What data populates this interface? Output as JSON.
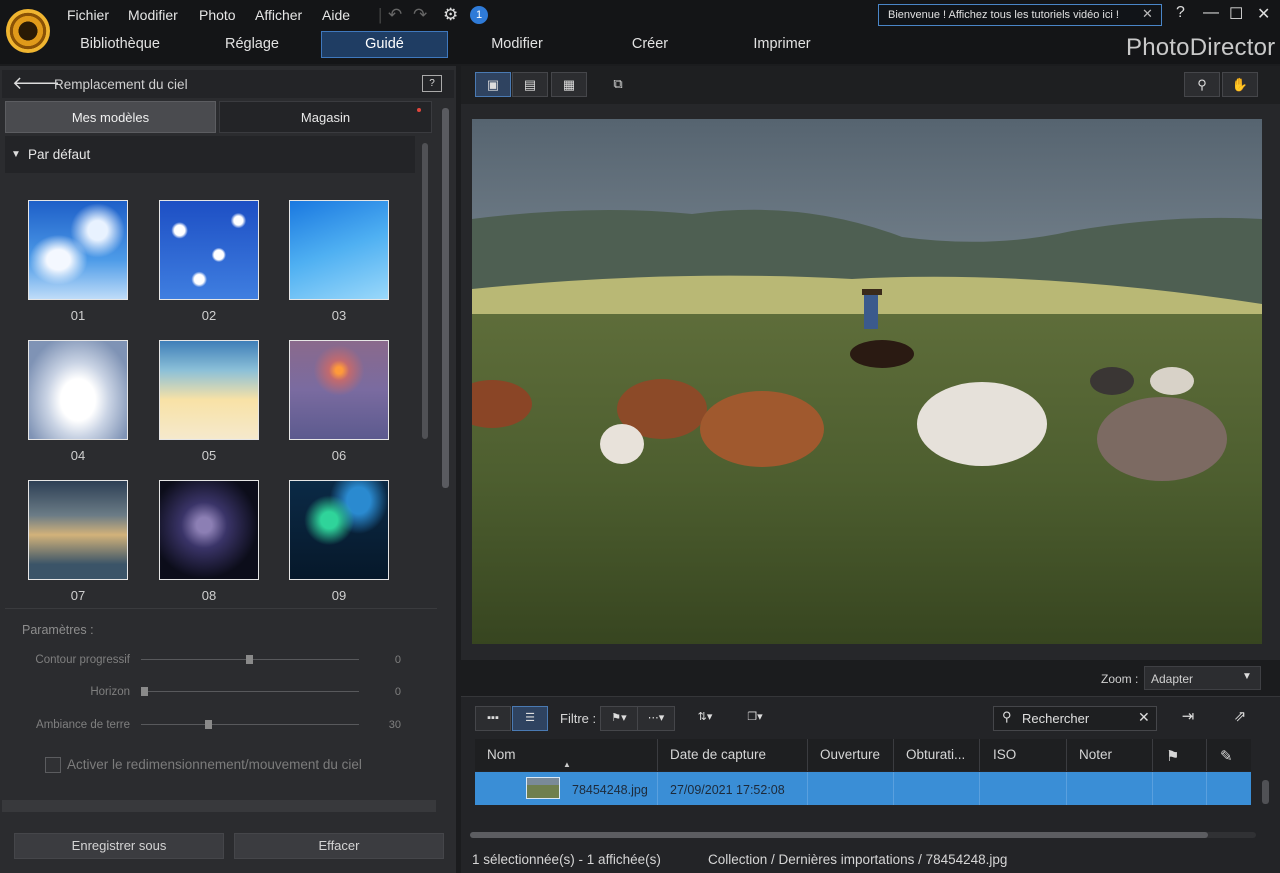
{
  "menu": [
    "Fichier",
    "Modifier",
    "Photo",
    "Afficher",
    "Aide"
  ],
  "notification_count": "1",
  "tutorial_banner": "Bienvenue ! Affichez tous les tutoriels vidéo ici !",
  "window_buttons": {
    "help": "?",
    "minimize": "—",
    "maximize": "☐",
    "close": "✕"
  },
  "modes": [
    "Bibliothèque",
    "Réglage",
    "Guidé",
    "Modifier",
    "Créer",
    "Imprimer"
  ],
  "active_mode": "Guidé",
  "brand": "PhotoDirector",
  "panel": {
    "title": "Remplacement du ciel",
    "tabs": {
      "mine": "Mes modèles",
      "store": "Magasin"
    },
    "category": "Par défaut",
    "templates": [
      "01",
      "02",
      "03",
      "04",
      "05",
      "06",
      "07",
      "08",
      "09"
    ],
    "params_title": "Paramètres :",
    "sliders": [
      {
        "label": "Contour progressif",
        "value": "0",
        "level": 0.5
      },
      {
        "label": "Horizon",
        "value": "0",
        "level": 0.0
      },
      {
        "label": "Ambiance de terre",
        "value": "30",
        "level": 0.3
      }
    ],
    "sky_checkbox": "Activer le redimensionnement/mouvement du ciel",
    "save_as": "Enregistrer sous",
    "clear": "Effacer"
  },
  "viewer": {
    "zoom_label": "Zoom :",
    "zoom_value": "Adapter"
  },
  "browser": {
    "filter_label": "Filtre :",
    "search_placeholder": "Rechercher",
    "columns": [
      "Nom",
      "Date de capture",
      "Ouverture",
      "Obturati...",
      "ISO",
      "Noter"
    ],
    "rows": [
      {
        "name": "78454248.jpg",
        "date": "27/09/2021 17:52:08"
      }
    ],
    "status_selection": "1 sélectionnée(s) - 1 affichée(s)",
    "status_path": "Collection / Dernières importations / 78454248.jpg"
  },
  "colors": {
    "accent": "#3a8ed6",
    "active_tab": "#1f3d63"
  }
}
